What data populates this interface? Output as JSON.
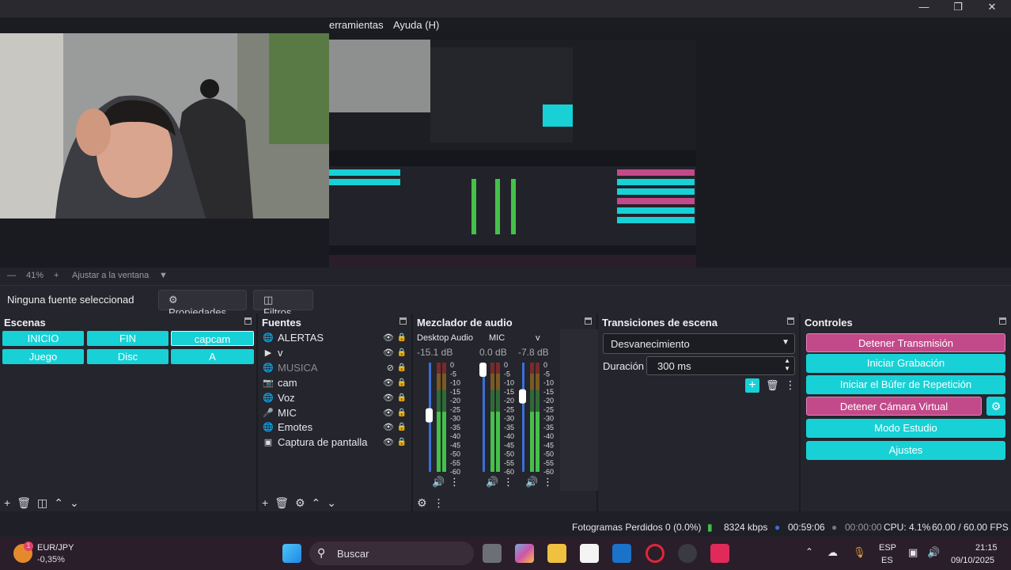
{
  "window": {
    "menu": [
      "erramientas",
      "Ayuda (H)"
    ],
    "controls": [
      "minimize-icon",
      "maximize-icon",
      "close-icon"
    ]
  },
  "preview": {
    "zoom": "41%",
    "fit_label": "Ajustar a la ventana"
  },
  "properties_bar": {
    "no_source": "Ninguna fuente seleccionad",
    "properties_label": "Propiedades",
    "filters_label": "Filtros"
  },
  "scenes": {
    "title": "Escenas",
    "items": [
      "INICIO",
      "FIN",
      "capcam",
      "Juego",
      "Disc",
      "A"
    ],
    "selected": "capcam"
  },
  "sources": {
    "title": "Fuentes",
    "items": [
      {
        "label": "ALERTAS",
        "icon": "globe-icon",
        "visible": true
      },
      {
        "label": "v",
        "icon": "media-icon",
        "visible": true
      },
      {
        "label": "MUSICA",
        "icon": "globe-icon",
        "visible": false
      },
      {
        "label": "cam",
        "icon": "camera-icon",
        "visible": true
      },
      {
        "label": "Voz",
        "icon": "globe-icon",
        "visible": true
      },
      {
        "label": "MIC",
        "icon": "microphone-icon",
        "visible": true
      },
      {
        "label": "Emotes",
        "icon": "globe-icon",
        "visible": true
      },
      {
        "label": "Captura de pantalla",
        "icon": "monitor-icon",
        "visible": true
      }
    ]
  },
  "mixer": {
    "title": "Mezclador de audio",
    "channels": [
      {
        "name": "Desktop Audio",
        "db": "-15.1 dB",
        "volume": 0.52
      },
      {
        "name": "MIC",
        "db": "0.0 dB",
        "volume": 1.0
      },
      {
        "name": "v",
        "db": "-7.8 dB",
        "volume": 0.72
      }
    ],
    "scale": [
      "0",
      "-5",
      "-10",
      "-15",
      "-20",
      "-25",
      "-30",
      "-35",
      "-40",
      "-45",
      "-50",
      "-55",
      "-60"
    ]
  },
  "transitions": {
    "title": "Transiciones de escena",
    "selected": "Desvanecimiento",
    "duration_label": "Duración",
    "duration_value": "300 ms"
  },
  "controls": {
    "title": "Controles",
    "buttons": [
      {
        "label": "Detener Transmisión",
        "active": true
      },
      {
        "label": "Iniciar Grabación",
        "active": false
      },
      {
        "label": "Iniciar el Búfer de Repetición",
        "active": false
      },
      {
        "label": "Detener Cámara Virtual",
        "active": true
      },
      {
        "label": "Modo Estudio",
        "active": false
      },
      {
        "label": "Ajustes",
        "active": false
      }
    ]
  },
  "status": {
    "dropped": "Fotogramas Perdidos 0 (0.0%)",
    "kbps": "8324 kbps",
    "stream_time": "00:59:06",
    "rec_time": "00:00:00",
    "cpu": "CPU: 4.1%",
    "fps": "60.00 / 60.00 FPS"
  },
  "taskbar": {
    "ticker": {
      "symbol": "EUR/JPY",
      "change": "-0,35%",
      "badge": "1"
    },
    "search_placeholder": "Buscar",
    "lang_top": "ESP",
    "lang_bottom": "ES",
    "time": "21:15",
    "date": "09/10/2025"
  },
  "colors": {
    "accent": "#17d1d6",
    "active": "#c24a8a",
    "panel": "#24252d"
  }
}
